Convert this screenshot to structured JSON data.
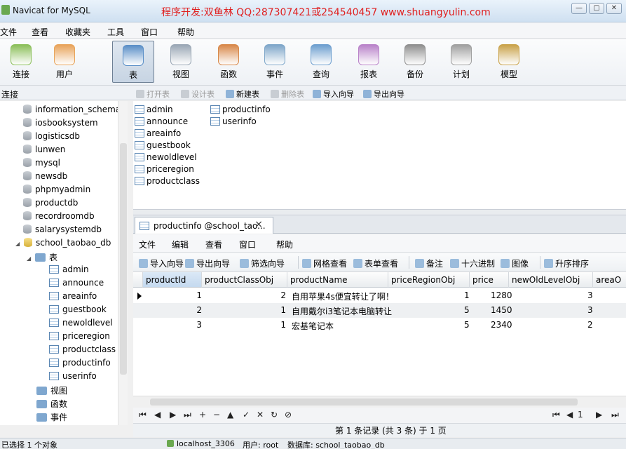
{
  "window": {
    "title": "Navicat for MySQL",
    "banner": "程序开发:双鱼林 QQ:287307421或254540457 www.shuangyulin.com",
    "controls": [
      "—",
      "▢",
      "✕"
    ]
  },
  "menu": [
    "文件",
    "查看",
    "收藏夹",
    "工具",
    "窗口",
    "帮助"
  ],
  "toolbar": [
    {
      "label": "连接",
      "icon": "connection-icon",
      "color": "#8bbf5a"
    },
    {
      "label": "用户",
      "icon": "user-icon",
      "color": "#e8a35a"
    },
    {
      "label": "表",
      "icon": "table-icon",
      "color": "#5b8fc7",
      "active": true
    },
    {
      "label": "视图",
      "icon": "view-icon",
      "color": "#9aa7b5"
    },
    {
      "label": "函数",
      "icon": "function-icon",
      "color": "#d8884a"
    },
    {
      "label": "事件",
      "icon": "event-icon",
      "color": "#7ea6c9"
    },
    {
      "label": "查询",
      "icon": "query-icon",
      "color": "#6d9fcf"
    },
    {
      "label": "报表",
      "icon": "report-icon",
      "color": "#b982c9"
    },
    {
      "label": "备份",
      "icon": "backup-icon",
      "color": "#8f8f8f"
    },
    {
      "label": "计划",
      "icon": "schedule-icon",
      "color": "#a0a0a0"
    },
    {
      "label": "模型",
      "icon": "model-icon",
      "color": "#c9a24a"
    }
  ],
  "conn_header": "连接",
  "subtoolbar": [
    {
      "label": "打开表",
      "disabled": true
    },
    {
      "label": "设计表",
      "disabled": true
    },
    {
      "label": "新建表",
      "disabled": false
    },
    {
      "label": "删除表",
      "disabled": true
    },
    {
      "label": "导入向导",
      "disabled": false
    },
    {
      "label": "导出向导",
      "disabled": false
    }
  ],
  "tree": {
    "databases": [
      "information_schema",
      "iosbooksystem",
      "logisticsdb",
      "lunwen",
      "mysql",
      "newsdb",
      "phpmyadmin",
      "productdb",
      "recordroomdb",
      "salarysystemdb"
    ],
    "open_db": "school_taobao_db",
    "tables_folder": "表",
    "tables": [
      "admin",
      "announce",
      "areainfo",
      "guestbook",
      "newoldlevel",
      "priceregion",
      "productclass",
      "productinfo",
      "userinfo"
    ],
    "views": "视图",
    "functions": "函数",
    "events": "事件"
  },
  "table_list": [
    "admin",
    "announce",
    "areainfo",
    "guestbook",
    "newoldlevel",
    "priceregion",
    "productclass",
    "productinfo",
    "userinfo"
  ],
  "editor": {
    "tab_title": "productinfo @school_tao...",
    "tab_close": "×",
    "menu": [
      "文件",
      "编辑",
      "查看",
      "窗口",
      "帮助"
    ],
    "toolbar": [
      "导入向导",
      "导出向导",
      "筛选向导",
      "网格查看",
      "表单查看",
      "备注",
      "十六进制",
      "图像",
      "升序排序"
    ],
    "columns": [
      "productId",
      "productClassObj",
      "productName",
      "priceRegionObj",
      "price",
      "newOldLevelObj",
      "areaO"
    ],
    "rows": [
      [
        "1",
        "2",
        "自用苹果4s便宜转让了啊！",
        "1",
        "1280",
        "",
        "3"
      ],
      [
        "2",
        "1",
        "自用戴尔i3笔记本电脑转让",
        "5",
        "1450",
        "",
        "3"
      ],
      [
        "3",
        "1",
        "宏基笔记本",
        "5",
        "2340",
        "",
        "2"
      ]
    ],
    "nav_buttons": [
      "⏮",
      "◀",
      "▶",
      "⏭",
      "+",
      "−",
      "▲",
      "✓",
      "✕",
      "↻",
      "⊘"
    ],
    "page_nav": [
      "⏮",
      "◀",
      "1",
      "▶",
      "⏭"
    ],
    "records_info": "第 1 条记录 (共 3 条) 于 1 页"
  },
  "status": {
    "selected": "已选择 1 个对象",
    "connection": "localhost_3306",
    "user": "用户: root",
    "database": "数据库: school_taobao_db"
  }
}
